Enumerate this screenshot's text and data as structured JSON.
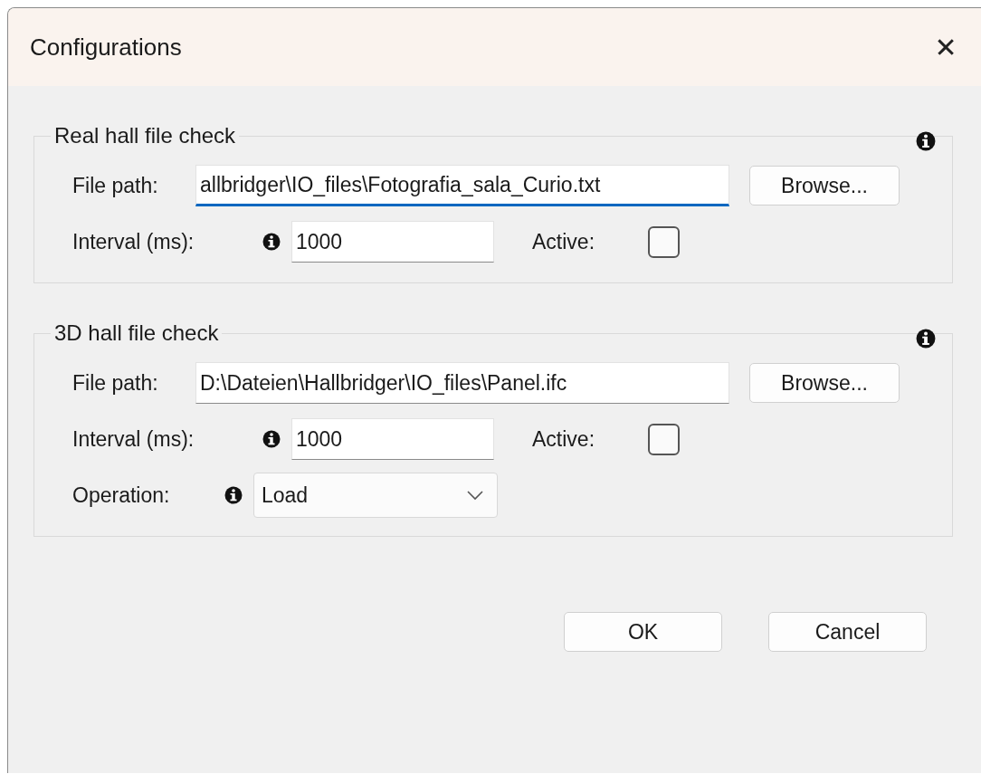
{
  "window": {
    "title": "Configurations",
    "close": "✕"
  },
  "groups": [
    {
      "title": "Real hall file check",
      "rows": [
        {
          "kind": "file",
          "label": "File path:",
          "value": "allbridger\\IO_files\\Fotografia_sala_Curio.txt",
          "focused": true,
          "button": "Browse..."
        },
        {
          "kind": "interval",
          "label": "Interval (ms):",
          "value": "1000",
          "active_label": "Active:",
          "checked": false
        }
      ]
    },
    {
      "title": "3D hall file check",
      "rows": [
        {
          "kind": "file",
          "label": "File path:",
          "value": "D:\\Dateien\\Hallbridger\\IO_files\\Panel.ifc",
          "focused": false,
          "button": "Browse..."
        },
        {
          "kind": "interval",
          "label": "Interval (ms):",
          "value": "1000",
          "active_label": "Active:",
          "checked": false
        },
        {
          "kind": "select",
          "label": "Operation:",
          "value": "Load"
        }
      ]
    }
  ],
  "buttons": [
    "OK",
    "Cancel"
  ]
}
